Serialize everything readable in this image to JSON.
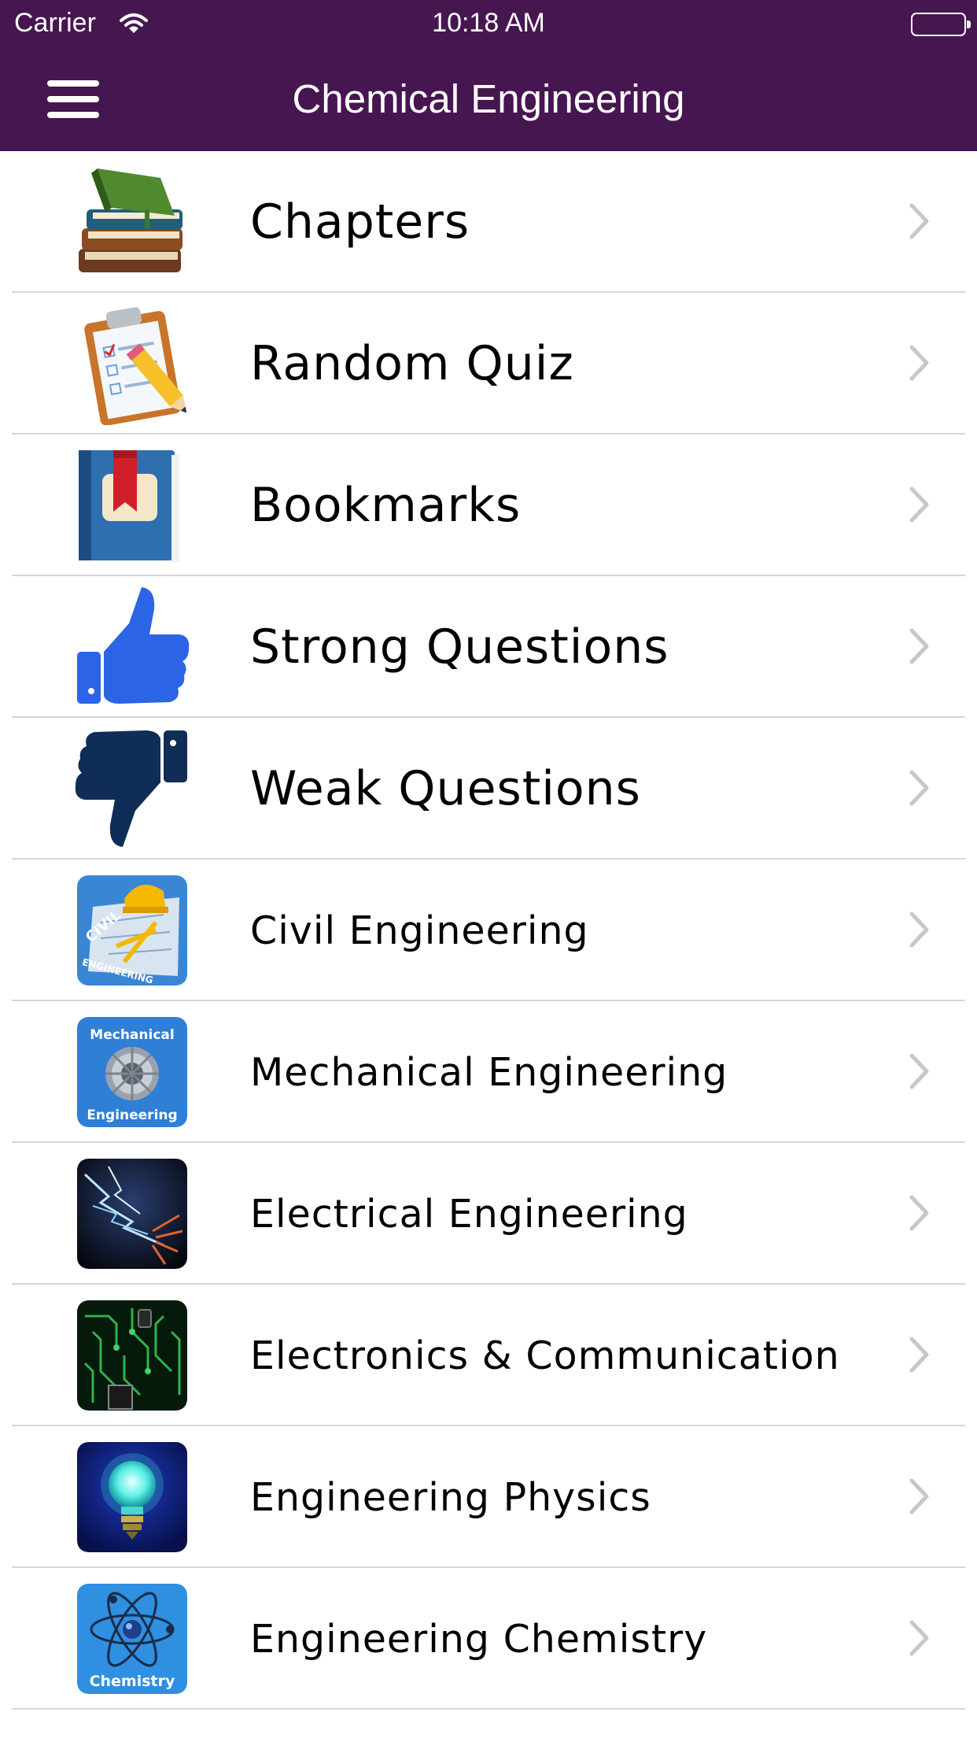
{
  "status_bar": {
    "carrier": "Carrier",
    "time": "10:18 AM",
    "wifi_icon": "wifi-icon",
    "battery_icon": "battery-icon"
  },
  "nav": {
    "title": "Chemical Engineering",
    "menu_icon": "hamburger-menu-icon"
  },
  "colors": {
    "nav_background": "#461651",
    "separator": "#d6d6d6",
    "chevron": "#c7c7cc"
  },
  "menu_items": [
    {
      "label": "Chapters",
      "icon": "books-icon"
    },
    {
      "label": "Random Quiz",
      "icon": "clipboard-pencil-icon"
    },
    {
      "label": "Bookmarks",
      "icon": "bookmark-book-icon"
    },
    {
      "label": "Strong Questions",
      "icon": "thumbs-up-icon"
    },
    {
      "label": "Weak Questions",
      "icon": "thumbs-down-icon"
    },
    {
      "label": "Civil Engineering",
      "icon": "civil-engineering-icon",
      "tile_text": "CIVIL ENGINEERING"
    },
    {
      "label": "Mechanical Engineering",
      "icon": "mechanical-engineering-icon",
      "tile_text_top": "Mechanical",
      "tile_text_bottom": "Engineering"
    },
    {
      "label": "Electrical Engineering",
      "icon": "electrical-engineering-icon"
    },
    {
      "label": "Electronics & Communication",
      "icon": "circuit-board-icon"
    },
    {
      "label": "Engineering Physics",
      "icon": "light-bulb-icon"
    },
    {
      "label": "Engineering Chemistry",
      "icon": "atom-icon",
      "tile_text": "Chemistry"
    }
  ]
}
